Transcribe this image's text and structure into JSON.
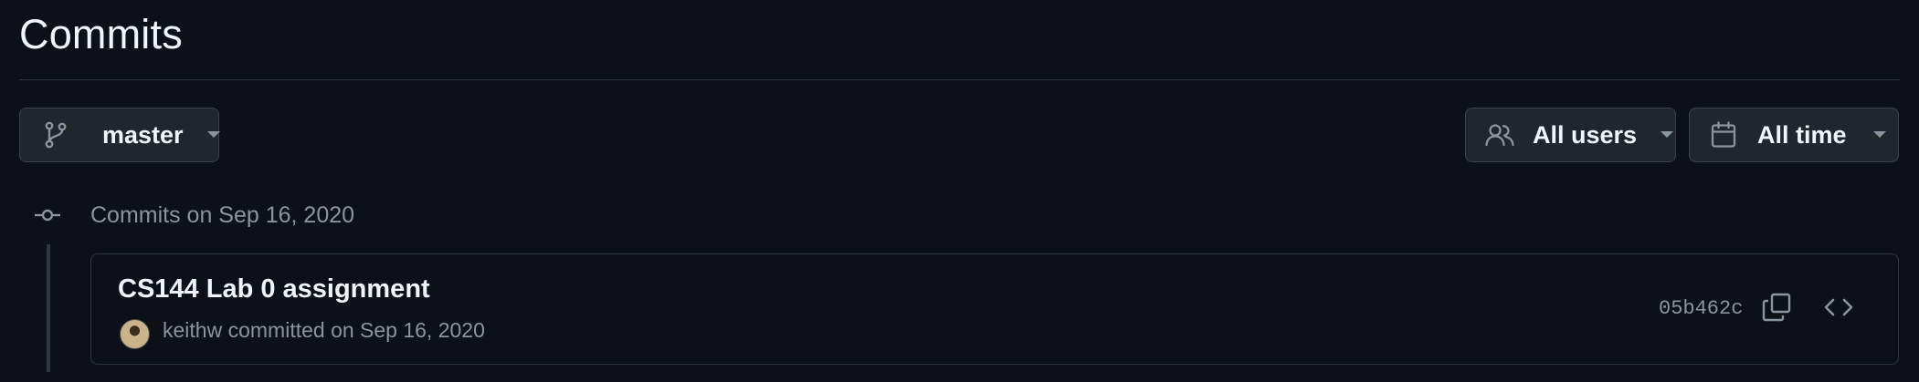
{
  "header": {
    "title": "Commits"
  },
  "filters": {
    "branch_label": "master",
    "users_label": "All users",
    "time_label": "All time"
  },
  "commit_groups": [
    {
      "header": "Commits on Sep 16, 2020",
      "commits": [
        {
          "title": "CS144 Lab 0 assignment",
          "author": "keithw",
          "committed_text": "committed on Sep 16, 2020",
          "sha": "05b462c"
        }
      ]
    }
  ],
  "icons": {
    "branch": "git-branch-icon",
    "users": "people-icon",
    "time": "calendar-icon",
    "commit": "git-commit-icon",
    "copy": "copy-icon",
    "browse": "code-icon"
  },
  "colors": {
    "background": "#0d1117",
    "button_bg": "#21262d",
    "border": "#30363d",
    "text": "#f0f6fc",
    "muted": "#8b949e"
  }
}
